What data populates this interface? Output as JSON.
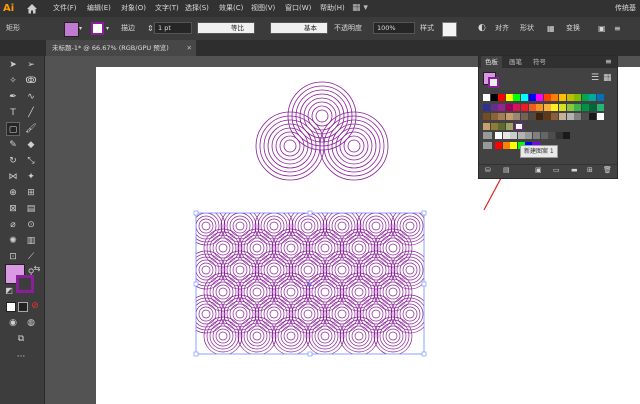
{
  "app": {
    "logo_text": "Ai",
    "user_label": "传统基"
  },
  "menu": [
    "文件(F)",
    "编辑(E)",
    "对象(O)",
    "文字(T)",
    "选择(S)",
    "效果(C)",
    "视图(V)",
    "窗口(W)",
    "帮助(H)"
  ],
  "control_bar": {
    "object_type": "矩形",
    "stroke_label": "描边",
    "stroke_value": "1 pt",
    "brush_label": "等比",
    "profile_label": "基本",
    "opacity_label": "不透明度",
    "opacity_value": "100%",
    "style_label": "样式",
    "align_label": "对齐",
    "shape_label": "形状",
    "transform_label": "变换"
  },
  "document_tab": {
    "title": "未标题-1* @ 66.67% (RGB/GPU 预览)"
  },
  "panel": {
    "tabs": [
      "色板",
      "画笔",
      "符号"
    ],
    "tooltip": "新建图案 1"
  },
  "colors": {
    "pattern": "#8a1f9a",
    "accent": "#ff9a00",
    "selection": "#6d8cff",
    "arrow": "#e02020"
  },
  "swatches": {
    "row1": [
      "#ffffff",
      "#000000",
      "#ff0000",
      "#ffff00",
      "#00ff00",
      "#00ffff",
      "#0000ff",
      "#ff00ff",
      "#ff3f00",
      "#ff7f00",
      "#ffbf00",
      "#bfbf00",
      "#7fbf00",
      "#00a651",
      "#00a99d",
      "#0072bc"
    ],
    "row2": [
      "#2e3192",
      "#662d91",
      "#92278f",
      "#9e005d",
      "#d4145a",
      "#ed1c24",
      "#f15a24",
      "#f7931e",
      "#fbb03b",
      "#fcee21",
      "#d9e021",
      "#8cc63f",
      "#39b54a",
      "#009245",
      "#006837",
      "#22b573"
    ],
    "row3": [
      "#754c24",
      "#8c6239",
      "#a67c52",
      "#c69c6d",
      "#998675",
      "#736357",
      "#534741",
      "#42210b",
      "#603813",
      "#8b5e3c",
      "#c7b299",
      "#b3b3b3",
      "#808080",
      "#4d4d4d",
      "#1a1a1a",
      "#ffffff"
    ],
    "row4": [
      "#c8a06b",
      "#8f7b3a",
      "#5e6d2e",
      "#a0a064"
    ],
    "gray_row": [
      "#ffffff",
      "#e6e6e6",
      "#cccccc",
      "#b3b3b3",
      "#999999",
      "#808080",
      "#666666",
      "#4d4d4d",
      "#333333",
      "#1a1a1a"
    ],
    "color_row": [
      "#ff0000",
      "#ff7f00",
      "#ffff00",
      "#00ff00",
      "#0000ff",
      "#7f00ff"
    ]
  }
}
